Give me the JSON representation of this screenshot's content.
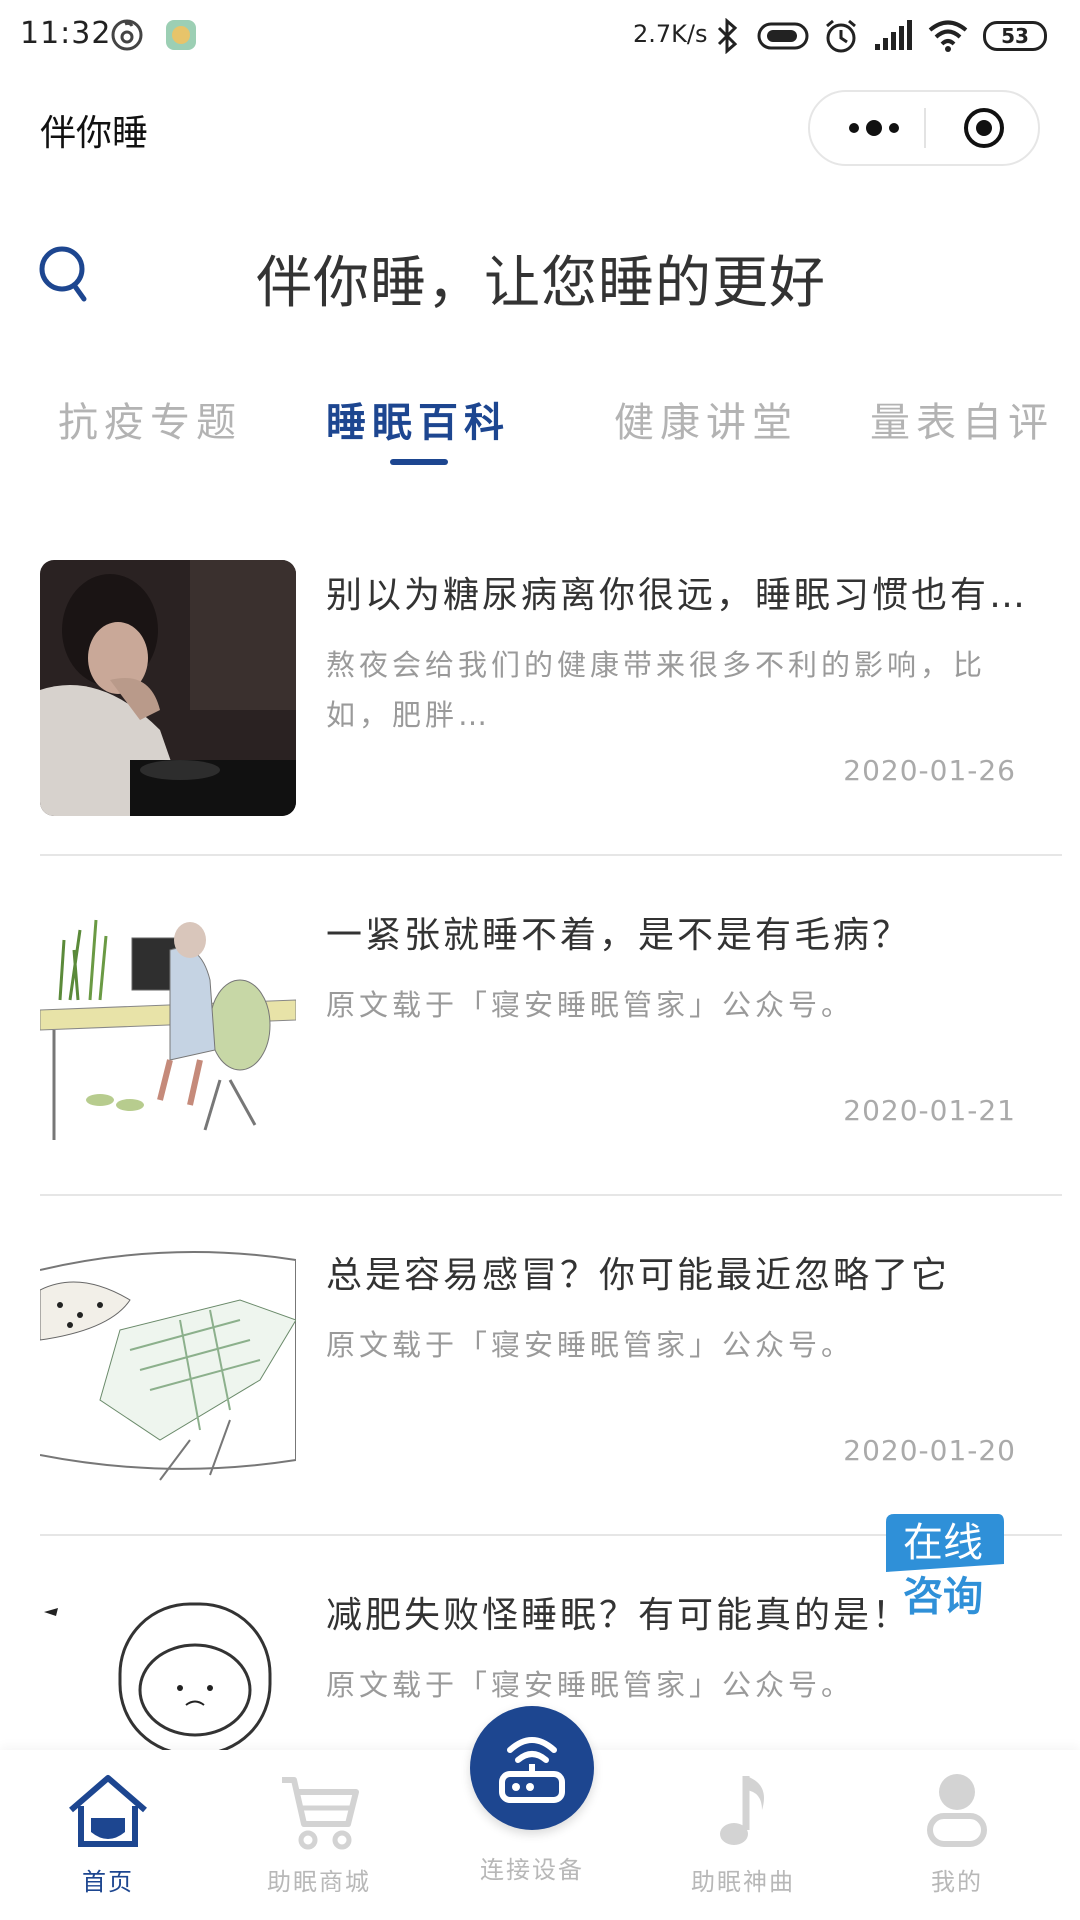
{
  "status_bar": {
    "time": "11:32",
    "speed": "2.7K/s",
    "battery": "53",
    "icons": [
      "netease-music-icon",
      "app-notification-icon",
      "bluetooth-icon",
      "vibrate-icon",
      "alarm-icon",
      "signal-icon",
      "wifi-icon",
      "battery-icon"
    ]
  },
  "nav": {
    "title": "伴你睡",
    "more_icon": "more-dots-icon",
    "close_icon": "close-target-icon"
  },
  "header": {
    "search_icon": "search-icon",
    "slogan": "伴你睡，让您睡的更好"
  },
  "tabs": [
    {
      "label": "抗疫专题",
      "active": false
    },
    {
      "label": "睡眠百科",
      "active": true
    },
    {
      "label": "健康讲堂",
      "active": false
    },
    {
      "label": "量表自评",
      "active": false
    }
  ],
  "articles": [
    {
      "title": "别以为糖尿病离你很远，睡眠习惯也有…",
      "summary": "熬夜会给我们的健康带来很多不利的影响，比如，肥胖…",
      "date": "2020-01-26"
    },
    {
      "title": "一紧张就睡不着，是不是有毛病？",
      "summary": "原文载于「寝安睡眠管家」公众号。",
      "date": "2020-01-21"
    },
    {
      "title": "总是容易感冒？你可能最近忽略了它",
      "summary": "原文载于「寝安睡眠管家」公众号。",
      "date": "2020-01-20"
    },
    {
      "title": "减肥失败怪睡眠？有可能真的是！",
      "summary": "原文载于「寝安睡眠管家」公众号。",
      "date": ""
    }
  ],
  "consult": {
    "line1": "在线",
    "line2": "咨询"
  },
  "tabbar": [
    {
      "label": "首页",
      "icon": "home-icon",
      "active": true
    },
    {
      "label": "助眠商城",
      "icon": "cart-icon",
      "active": false
    },
    {
      "label": "连接设备",
      "icon": "router-icon",
      "active": false
    },
    {
      "label": "助眠神曲",
      "icon": "music-note-icon",
      "active": false
    },
    {
      "label": "我的",
      "icon": "user-icon",
      "active": false
    }
  ],
  "colors": {
    "primary": "#1d4690",
    "inactive": "#b3b3b3",
    "text": "#333333",
    "muted": "#9a9a9a"
  }
}
